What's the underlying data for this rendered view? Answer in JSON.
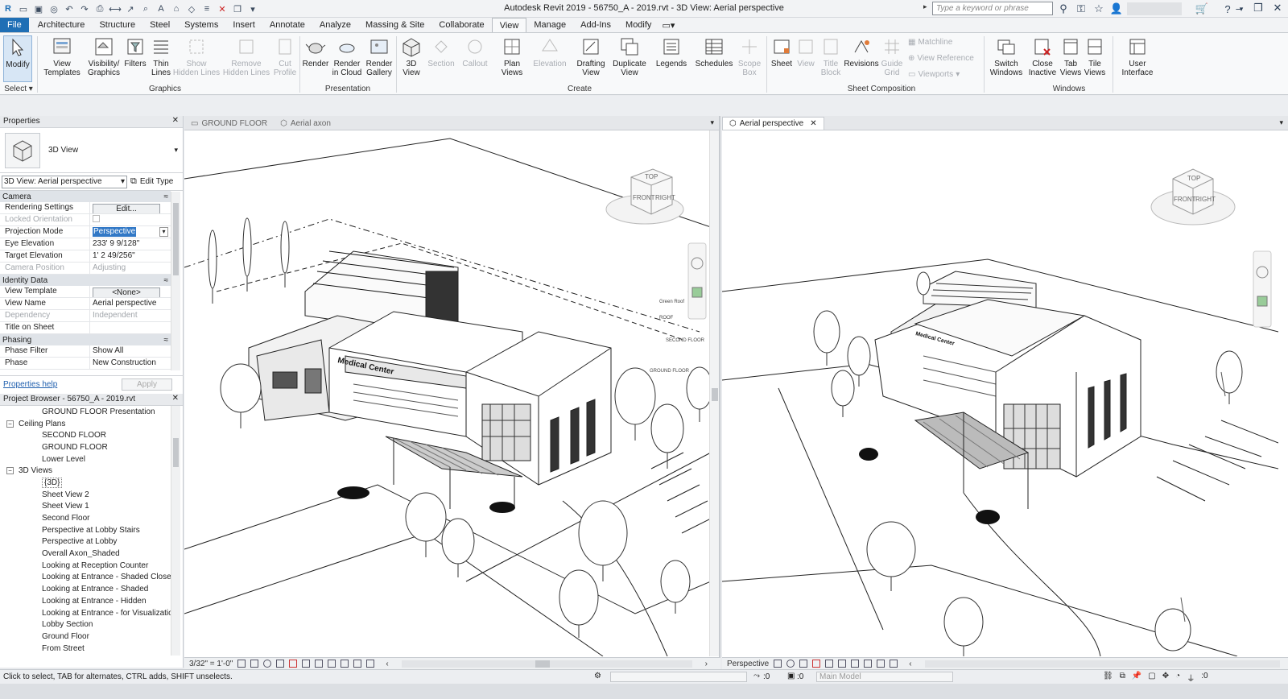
{
  "titlebar": {
    "title": "Autodesk Revit 2019 - 56750_A - 2019.rvt - 3D View: Aerial perspective",
    "search_placeholder": "Type a keyword or phrase"
  },
  "menu": {
    "file": "File",
    "tabs": [
      "Architecture",
      "Structure",
      "Steel",
      "Systems",
      "Insert",
      "Annotate",
      "Analyze",
      "Massing & Site",
      "Collaborate",
      "View",
      "Manage",
      "Add-Ins",
      "Modify"
    ],
    "active": "View"
  },
  "ribbon": {
    "select": {
      "modify": "Modify",
      "select_label": "Select"
    },
    "graphics": {
      "label": "Graphics",
      "buttons": [
        "View\nTemplates",
        "Visibility/\nGraphics",
        "Filters",
        "Thin\nLines",
        "Show\nHidden Lines",
        "Remove\nHidden Lines",
        "Cut\nProfile"
      ]
    },
    "presentation": {
      "label": "Presentation",
      "buttons": [
        "Render",
        "Render\nin Cloud",
        "Render\nGallery"
      ]
    },
    "create": {
      "label": "Create",
      "buttons": [
        "3D\nView",
        "Section",
        "Callout",
        "Plan\nViews",
        "Elevation",
        "Drafting\nView",
        "Duplicate\nView",
        "Legends",
        "Schedules",
        "Scope\nBox"
      ]
    },
    "sheet_composition": {
      "label": "Sheet Composition",
      "buttons": [
        "Sheet",
        "View",
        "Title\nBlock",
        "Revisions",
        "Guide\nGrid"
      ],
      "small": [
        "Matchline",
        "View Reference",
        "Viewports"
      ]
    },
    "windows": {
      "label": "Windows",
      "buttons": [
        "Switch\nWindows",
        "Close\nInactive",
        "Tab\nViews",
        "Tile\nViews",
        "User\nInterface"
      ]
    }
  },
  "properties": {
    "title": "Properties",
    "type_name": "3D View",
    "view_selector": "3D View: Aerial perspective",
    "edit_type": "Edit Type",
    "sections": {
      "camera": "Camera",
      "identity": "Identity Data",
      "phasing": "Phasing"
    },
    "rows": {
      "rendering_settings": {
        "k": "Rendering Settings",
        "v": "Edit..."
      },
      "locked_orientation": {
        "k": "Locked Orientation",
        "v": ""
      },
      "projection_mode": {
        "k": "Projection Mode",
        "v": "Perspective"
      },
      "eye_elevation": {
        "k": "Eye Elevation",
        "v": "233'  9 9/128\""
      },
      "target_elevation": {
        "k": "Target Elevation",
        "v": "1'  2 49/256\""
      },
      "camera_position": {
        "k": "Camera Position",
        "v": "Adjusting"
      },
      "view_template": {
        "k": "View Template",
        "v": "<None>"
      },
      "view_name": {
        "k": "View Name",
        "v": "Aerial perspective"
      },
      "dependency": {
        "k": "Dependency",
        "v": "Independent"
      },
      "title_on_sheet": {
        "k": "Title on Sheet",
        "v": ""
      },
      "phase_filter": {
        "k": "Phase Filter",
        "v": "Show All"
      },
      "phase": {
        "k": "Phase",
        "v": "New Construction"
      }
    },
    "help": "Properties help",
    "apply": "Apply"
  },
  "browser": {
    "title": "Project Browser - 56750_A - 2019.rvt",
    "items": [
      {
        "label": "GROUND FLOOR Presentation",
        "level": 2
      },
      {
        "label": "Ceiling Plans",
        "level": 1,
        "toggle": "−"
      },
      {
        "label": "SECOND FLOOR",
        "level": 2
      },
      {
        "label": "GROUND FLOOR",
        "level": 2
      },
      {
        "label": "Lower Level",
        "level": 2
      },
      {
        "label": "3D Views",
        "level": 1,
        "toggle": "−"
      },
      {
        "label": "{3D}",
        "level": 2
      },
      {
        "label": "Sheet View 2",
        "level": 2
      },
      {
        "label": "Sheet View 1",
        "level": 2
      },
      {
        "label": "Second Floor",
        "level": 2
      },
      {
        "label": "Perspective at Lobby Stairs",
        "level": 2
      },
      {
        "label": "Perspective at Lobby",
        "level": 2
      },
      {
        "label": "Overall Axon_Shaded",
        "level": 2
      },
      {
        "label": "Looking at Reception Counter",
        "level": 2
      },
      {
        "label": "Looking at Entrance - Shaded Close",
        "level": 2
      },
      {
        "label": "Looking at Entrance - Shaded",
        "level": 2
      },
      {
        "label": "Looking at Entrance - Hidden",
        "level": 2
      },
      {
        "label": "Looking at Entrance - for Visualizatio",
        "level": 2
      },
      {
        "label": "Lobby Section",
        "level": 2
      },
      {
        "label": "Ground Floor",
        "level": 2
      },
      {
        "label": "From Street",
        "level": 2
      }
    ]
  },
  "views": {
    "left_tabs": [
      "GROUND FLOOR",
      "Aerial axon"
    ],
    "right_tab": "Aerial perspective",
    "left_scale": "3/32\" = 1'-0\"",
    "right_mode": "Perspective",
    "building_sign": "Medical Center",
    "viewcube": {
      "top": "TOP",
      "front": "FRONT",
      "right": "RIGHT"
    },
    "level_tags": [
      "Green Roof",
      "ROOF",
      "SECOND FLOOR",
      "GROUND FLOOR"
    ]
  },
  "status": {
    "hint": "Click to select, TAB for alternates, CTRL adds, SHIFT unselects.",
    "zero": ":0",
    "model": "Main Model"
  },
  "colors": {
    "file_tab": "#1f6fb5",
    "accent": "#3b82c4"
  }
}
